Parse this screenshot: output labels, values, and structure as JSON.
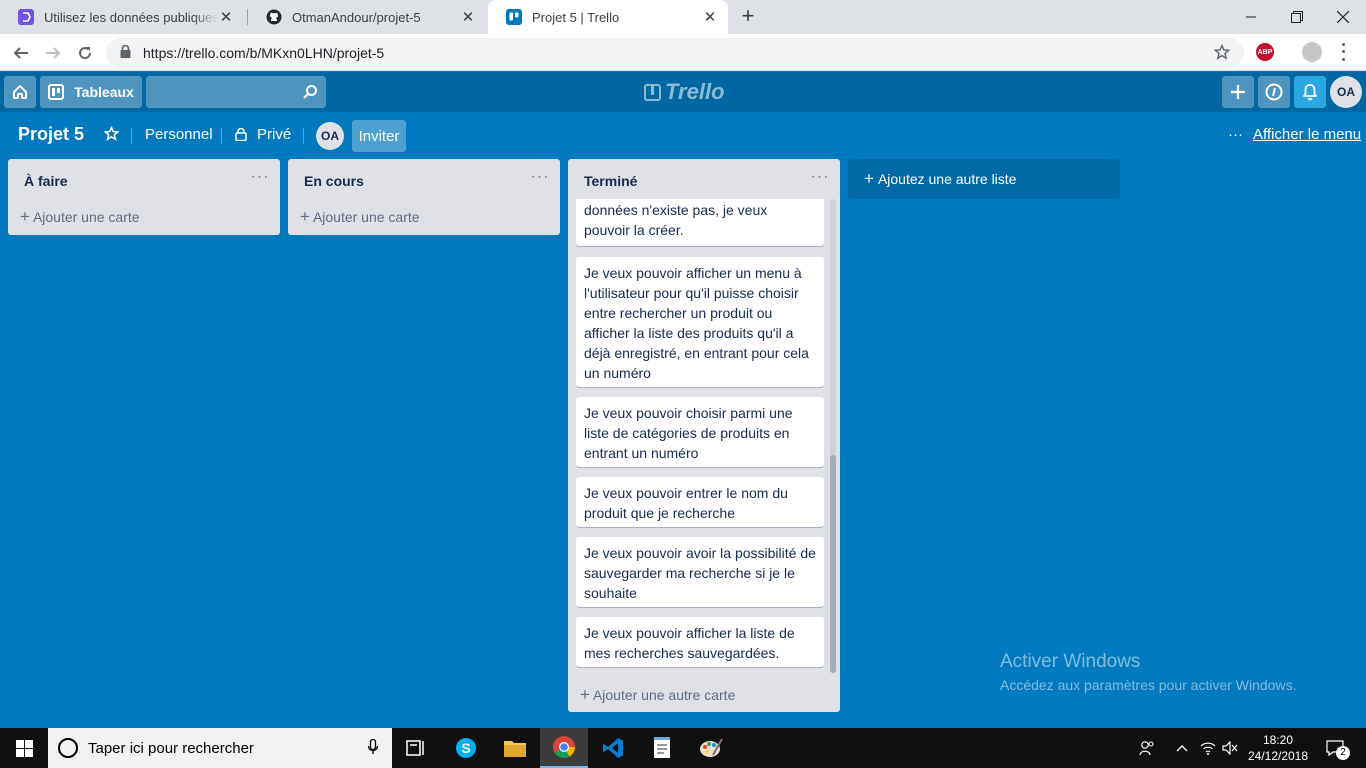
{
  "browser": {
    "tabs": [
      {
        "title": "Utilisez les données publiques de",
        "favicon": "oc-icon",
        "active": false
      },
      {
        "title": "OtmanAndour/projet-5",
        "favicon": "github-icon",
        "active": false
      },
      {
        "title": "Projet 5 | Trello",
        "favicon": "trello-icon",
        "active": true
      }
    ],
    "url": "https://trello.com/b/MKxn0LHN/projet-5",
    "extension_label": "ABP"
  },
  "header": {
    "boards_label": "Tableaux",
    "logo_text": "Trello",
    "avatar_initials": "OA"
  },
  "board": {
    "title": "Projet 5",
    "team_label": "Personnel",
    "visibility_label": "Privé",
    "member_initials": "OA",
    "invite_label": "Inviter",
    "menu_label": "Afficher le menu"
  },
  "lists": [
    {
      "title": "À faire",
      "add_card": "Ajouter une carte",
      "cards": []
    },
    {
      "title": "En cours",
      "add_card": "Ajouter une carte",
      "cards": []
    },
    {
      "title": "Terminé",
      "add_card": "Ajouter une autre carte",
      "cards": [
        "données n'existe pas, je veux pouvoir la créer.",
        "Je veux pouvoir afficher un menu à l'utilisateur pour qu'il puisse choisir entre rechercher un produit ou afficher la liste des produits qu'il a déjà enregistré, en entrant pour cela un numéro",
        "Je veux pouvoir choisir parmi une liste de catégories de produits en entrant un numéro",
        "Je veux pouvoir entrer le nom du produit que je recherche",
        "Je veux pouvoir avoir la possibilité de sauvegarder ma recherche si je le souhaite",
        "Je veux pouvoir afficher la liste de mes recherches sauvegardées."
      ]
    }
  ],
  "add_list_label": "Ajoutez une autre liste",
  "watermark": {
    "title": "Activer Windows",
    "subtitle": "Accédez aux paramètres pour activer Windows."
  },
  "taskbar": {
    "search_placeholder": "Taper ici pour rechercher",
    "time": "18:20",
    "date": "24/12/2018",
    "notification_count": "2"
  },
  "colors": {
    "board_bg": "#0079bf",
    "header_bg": "#0067a3",
    "list_bg": "#dfe1e6",
    "taskbar_bg": "#101010"
  }
}
